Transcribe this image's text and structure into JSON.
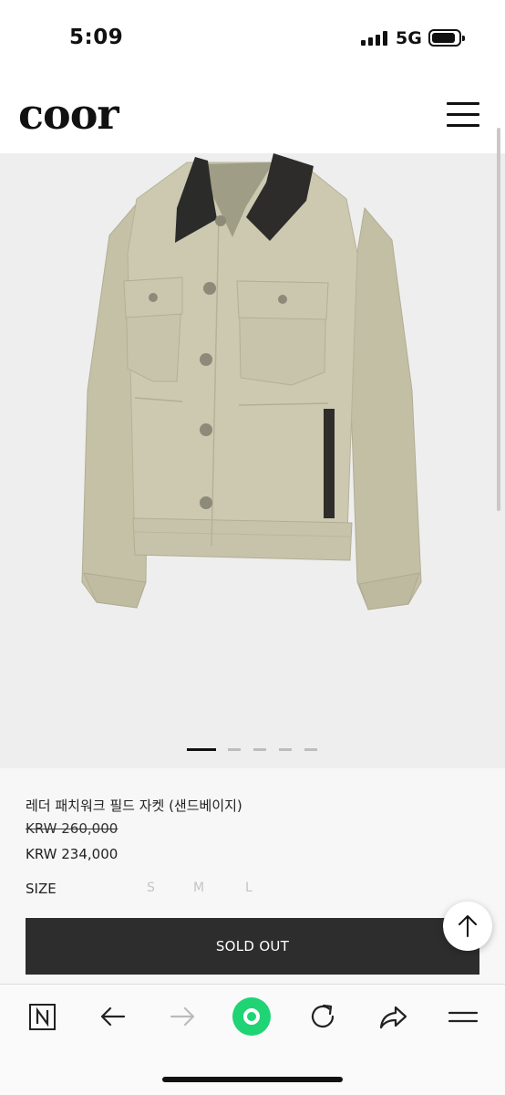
{
  "status_bar": {
    "time": "5:09",
    "network": "5G"
  },
  "header": {
    "logo": "coor",
    "menu_icon": "hamburger-menu-icon"
  },
  "gallery": {
    "slide_count": 5,
    "active_slide": 1
  },
  "product": {
    "name": "레더 패치워크 필드 자켓 (샌드베이지)",
    "original_price": "KRW 260,000",
    "sale_price": "KRW 234,000",
    "size_label": "SIZE",
    "sizes": [
      "S",
      "M",
      "L"
    ],
    "buy_button_label": "SOLD OUT"
  },
  "scroll_top": {
    "icon": "arrow-up-icon"
  },
  "browser_toolbar": {
    "items": [
      {
        "name": "naver-n-icon"
      },
      {
        "name": "back-arrow-icon"
      },
      {
        "name": "forward-arrow-icon"
      },
      {
        "name": "green-dot-icon"
      },
      {
        "name": "refresh-icon"
      },
      {
        "name": "share-icon"
      },
      {
        "name": "menu-icon"
      }
    ]
  },
  "colors": {
    "gallery_bg": "#efeeee",
    "info_bg": "#f7f7f7",
    "button_bg": "#2d2d2d",
    "accent_green": "#1fd474",
    "jacket": "#c9c6ad"
  }
}
